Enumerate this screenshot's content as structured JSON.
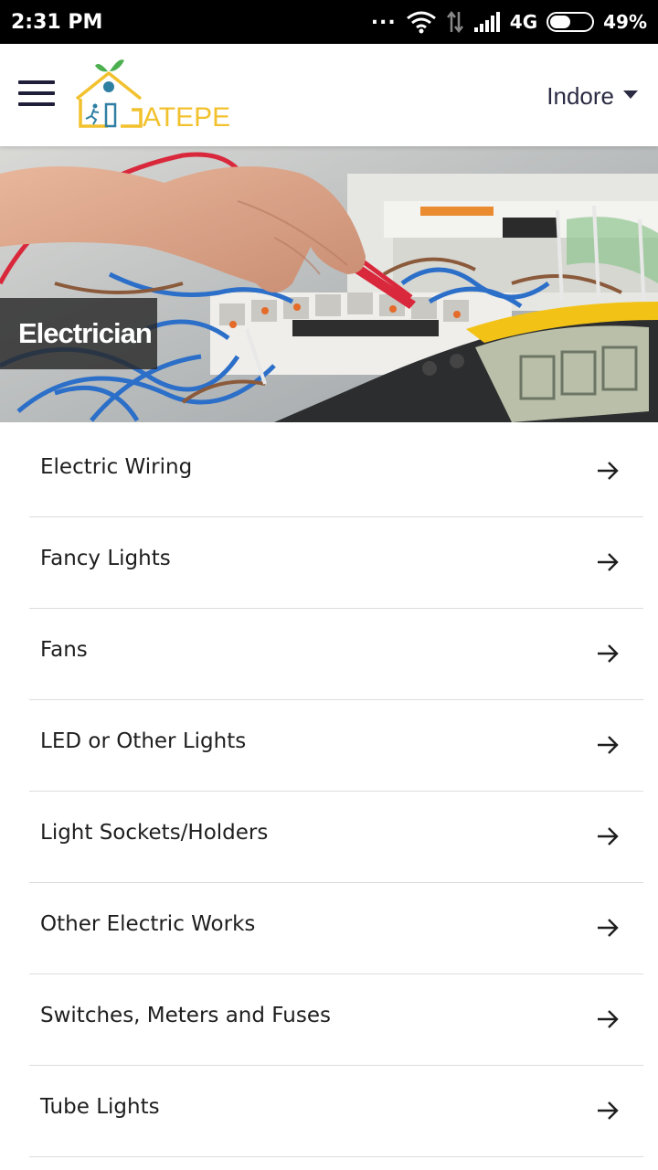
{
  "status_bar": {
    "time": "2:31 PM",
    "dots": "...",
    "network": "4G",
    "battery": "49%",
    "battery_level": 0.49,
    "icons": [
      "wifi-icon",
      "data-arrows-icon",
      "signal-icon",
      "battery-icon"
    ]
  },
  "app_bar": {
    "menu_icon": "hamburger-menu-icon",
    "logo_text": "ATEPE",
    "location": "Indore",
    "location_icon": "caret-down-icon"
  },
  "hero": {
    "title": "Electrician"
  },
  "services": [
    {
      "label": "Electric Wiring",
      "icon": "arrow-right-icon"
    },
    {
      "label": "Fancy Lights",
      "icon": "arrow-right-icon"
    },
    {
      "label": "Fans",
      "icon": "arrow-right-icon"
    },
    {
      "label": "LED or Other Lights",
      "icon": "arrow-right-icon"
    },
    {
      "label": "Light Sockets/Holders",
      "icon": "arrow-right-icon"
    },
    {
      "label": "Other Electric Works",
      "icon": "arrow-right-icon"
    },
    {
      "label": "Switches, Meters and Fuses",
      "icon": "arrow-right-icon"
    },
    {
      "label": "Tube Lights",
      "icon": "arrow-right-icon"
    }
  ],
  "colors": {
    "status_bar_bg": "#000000",
    "app_bar_text": "#2b2b44",
    "logo_yellow": "#f2c12e",
    "logo_green": "#4caf50",
    "logo_blue": "#2f7fa3",
    "divider": "#dcdcdc"
  }
}
